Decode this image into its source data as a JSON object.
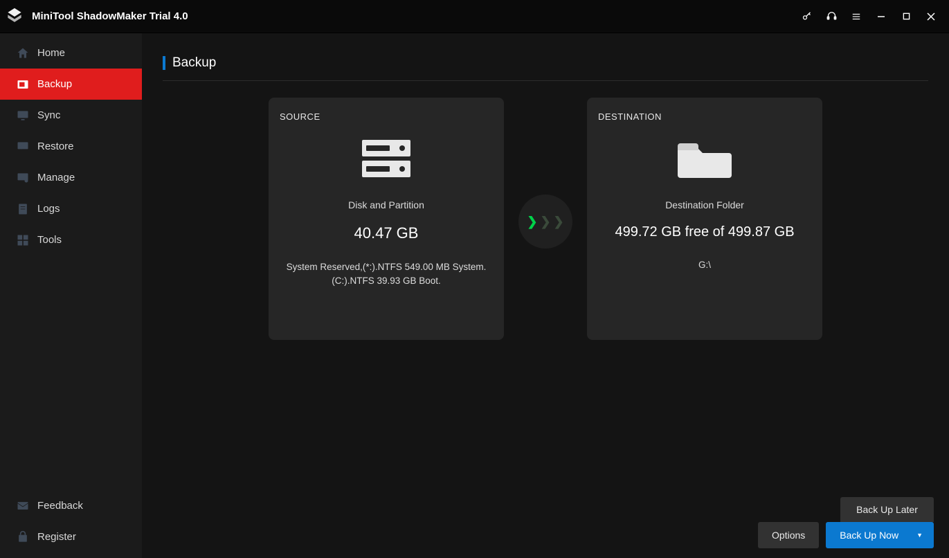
{
  "app": {
    "title": "MiniTool ShadowMaker Trial 4.0"
  },
  "titlebar_icons": {
    "key": "key-icon",
    "headset": "support-icon",
    "menu": "menu-icon",
    "minimize": "minimize-icon",
    "maximize": "maximize-icon",
    "close": "close-icon"
  },
  "sidebar": {
    "top": [
      {
        "label": "Home",
        "icon": "home-icon"
      },
      {
        "label": "Backup",
        "icon": "backup-icon",
        "active": true
      },
      {
        "label": "Sync",
        "icon": "sync-icon"
      },
      {
        "label": "Restore",
        "icon": "restore-icon"
      },
      {
        "label": "Manage",
        "icon": "manage-icon"
      },
      {
        "label": "Logs",
        "icon": "logs-icon"
      },
      {
        "label": "Tools",
        "icon": "tools-icon"
      }
    ],
    "bottom": [
      {
        "label": "Feedback",
        "icon": "feedback-icon"
      },
      {
        "label": "Register",
        "icon": "register-icon"
      }
    ]
  },
  "page": {
    "title": "Backup"
  },
  "source": {
    "label": "SOURCE",
    "subtitle": "Disk and Partition",
    "size": "40.47 GB",
    "details": "System Reserved,(*:).NTFS 549.00 MB System.(C:).NTFS 39.93 GB Boot."
  },
  "destination": {
    "label": "DESTINATION",
    "subtitle": "Destination Folder",
    "free_text": "499.72 GB free of 499.87 GB",
    "path": "G:\\"
  },
  "buttons": {
    "later": "Back Up Later",
    "options": "Options",
    "now": "Back Up Now"
  }
}
